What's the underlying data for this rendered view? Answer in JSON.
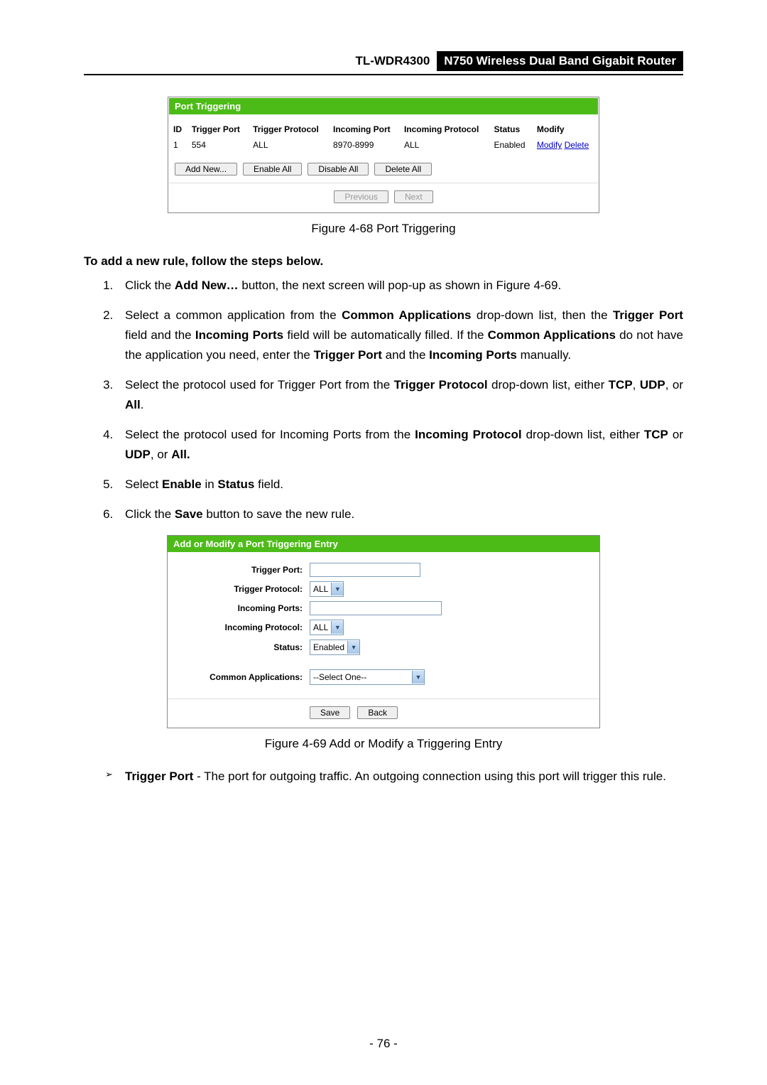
{
  "header": {
    "model": "TL-WDR4300",
    "description": "N750 Wireless Dual Band Gigabit Router"
  },
  "panel1": {
    "title": "Port Triggering",
    "columns": [
      "ID",
      "Trigger Port",
      "Trigger Protocol",
      "Incoming Port",
      "Incoming Protocol",
      "Status",
      "Modify"
    ],
    "rows": [
      {
        "id": "1",
        "trigger_port": "554",
        "trigger_protocol": "ALL",
        "incoming_port": "8970-8999",
        "incoming_protocol": "ALL",
        "status": "Enabled",
        "modify": "Modify",
        "delete": "Delete"
      }
    ],
    "buttons": {
      "add": "Add New...",
      "enable": "Enable All",
      "disable": "Disable All",
      "deleteall": "Delete All",
      "prev": "Previous",
      "next": "Next"
    }
  },
  "caption1": "Figure 4-68 Port Triggering",
  "intro": "To add a new rule, follow the steps below.",
  "steps": {
    "s1_a": "Click the ",
    "s1_b": "Add New…",
    "s1_c": " button, the next screen will pop-up as shown in Figure 4-69.",
    "s2_a": "Select a common application from the ",
    "s2_b": "Common Applications",
    "s2_c": " drop-down list, then the ",
    "s2_d": "Trigger Port",
    "s2_e": " field and the ",
    "s2_f": "Incoming Ports",
    "s2_g": " field will be automatically filled. If the ",
    "s2_h": "Common Applications",
    "s2_i": " do not have the application you need, enter the ",
    "s2_j": "Trigger Port",
    "s2_k": " and the ",
    "s2_l": "Incoming Ports",
    "s2_m": " manually.",
    "s3_a": "Select the protocol used for Trigger Port from the ",
    "s3_b": "Trigger Protocol",
    "s3_c": " drop-down list, either ",
    "s3_d": "TCP",
    "s3_e": ", ",
    "s3_f": "UDP",
    "s3_g": ", or ",
    "s3_h": "All",
    "s3_i": ".",
    "s4_a": "Select the protocol used for Incoming Ports from the ",
    "s4_b": "Incoming Protocol",
    "s4_c": " drop-down list, either ",
    "s4_d": "TCP",
    "s4_e": " or ",
    "s4_f": "UDP",
    "s4_g": ", or ",
    "s4_h": "All.",
    "s5_a": "Select ",
    "s5_b": "Enable",
    "s5_c": " in ",
    "s5_d": "Status",
    "s5_e": " field.",
    "s6_a": "Click the ",
    "s6_b": "Save",
    "s6_c": " button to save the new rule."
  },
  "panel2": {
    "title": "Add or Modify a Port Triggering Entry",
    "labels": {
      "trigger_port": "Trigger Port:",
      "trigger_protocol": "Trigger Protocol:",
      "incoming_ports": "Incoming Ports:",
      "incoming_protocol": "Incoming Protocol:",
      "status": "Status:",
      "common": "Common Applications:"
    },
    "values": {
      "trigger_protocol": "ALL",
      "incoming_protocol": "ALL",
      "status": "Enabled",
      "common": "--Select One--"
    },
    "buttons": {
      "save": "Save",
      "back": "Back"
    }
  },
  "caption2": "Figure 4-69 Add or Modify a Triggering Entry",
  "bullet": {
    "b1_a": "Trigger Port",
    "b1_b": " - The port for outgoing traffic. An outgoing connection using this port will trigger this rule."
  },
  "page_number": "- 76 -"
}
